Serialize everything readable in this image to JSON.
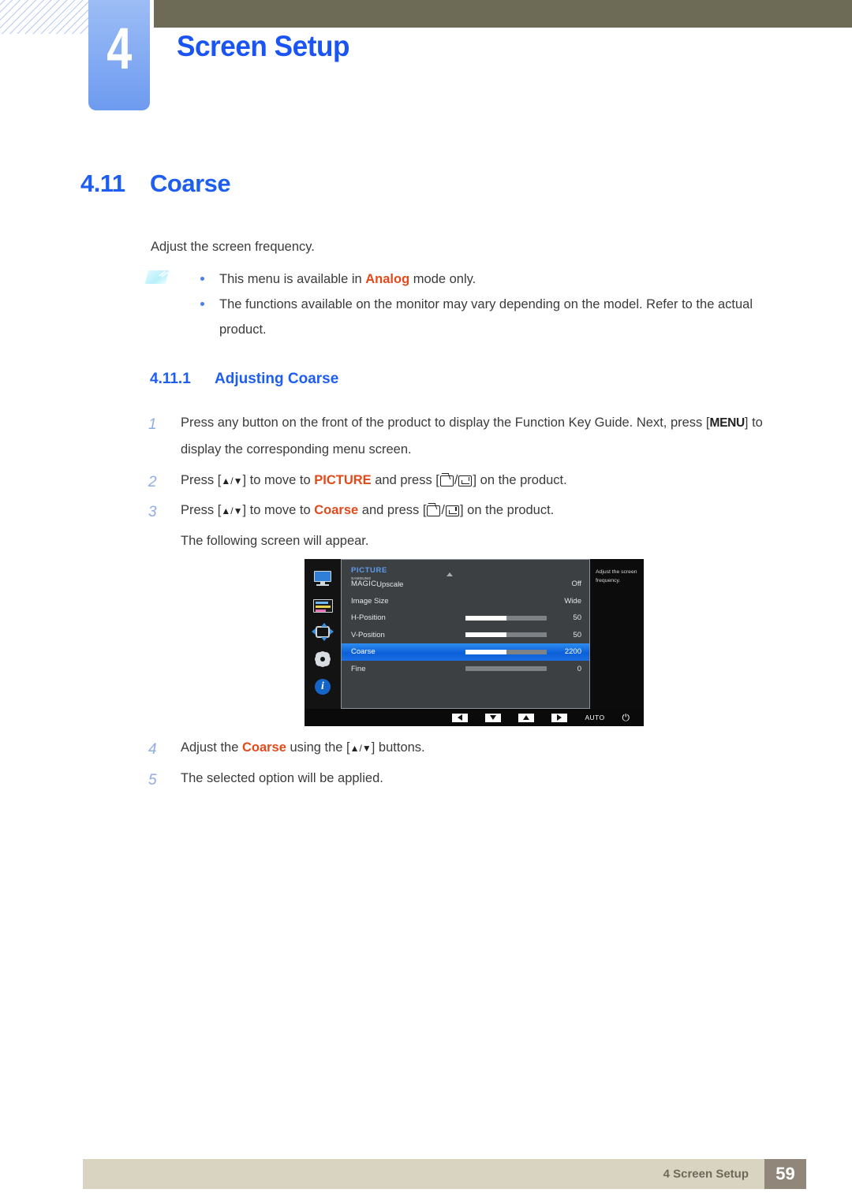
{
  "chapter": {
    "number": "4",
    "title": "Screen Setup"
  },
  "section": {
    "number": "4.11",
    "title": "Coarse",
    "intro": "Adjust the screen frequency."
  },
  "note": {
    "icon": "note-pencil-icon",
    "bullets": [
      {
        "prefix": "This menu is available in ",
        "keyword": "Analog",
        "suffix": " mode only."
      },
      {
        "prefix": "The functions available on the monitor may vary depending on the model. Refer to the actual product.",
        "keyword": "",
        "suffix": ""
      }
    ]
  },
  "subsection": {
    "number": "4.11.1",
    "title": "Adjusting Coarse"
  },
  "steps": [
    {
      "num": "1",
      "text_a": "Press any button on the front of the product to display the Function Key Guide. Next, press [",
      "key": "MENU",
      "text_b": "] to display the corresponding menu screen."
    },
    {
      "num": "2",
      "text_a": "Press [",
      "arrows": "▲/▼",
      "text_b": "] to move to ",
      "keyword": "PICTURE",
      "text_c": " and press [",
      "text_d": "] on the product."
    },
    {
      "num": "3",
      "text_a": "Press [",
      "arrows": "▲/▼",
      "text_b": "] to move to ",
      "keyword": "Coarse",
      "text_c": " and press [",
      "text_d": "] on the product.",
      "note": "The following screen will appear."
    },
    {
      "num": "4",
      "text_a": "Adjust the ",
      "keyword": "Coarse",
      "text_b": " using the [",
      "arrows": "▲/▼",
      "text_c": "] buttons."
    },
    {
      "num": "5",
      "text_a": "The selected option will be applied."
    }
  ],
  "osd": {
    "menu_title": "PICTURE",
    "sidebar_icons": [
      "monitor-icon",
      "color-bars-icon",
      "screen-adjust-icon",
      "gear-icon",
      "info-icon"
    ],
    "rows": [
      {
        "label_samsung": "SAMSUNG",
        "label_magic": "MAGIC",
        "label_extra": "Upscale",
        "value": "Off",
        "slider": null,
        "selected": false
      },
      {
        "label": "Image Size",
        "value": "Wide",
        "slider": null,
        "selected": false
      },
      {
        "label": "H-Position",
        "value": "50",
        "slider": 50,
        "selected": false
      },
      {
        "label": "V-Position",
        "value": "50",
        "slider": 50,
        "selected": false
      },
      {
        "label": "Coarse",
        "value": "2200",
        "slider": 50,
        "selected": true
      },
      {
        "label": "Fine",
        "value": "0",
        "slider": 0,
        "selected": false
      }
    ],
    "description": "Adjust the screen frequency.",
    "keybar": [
      {
        "icon": "arrow-left-button",
        "label": ""
      },
      {
        "icon": "arrow-down-button",
        "label": ""
      },
      {
        "icon": "arrow-up-button",
        "label": ""
      },
      {
        "icon": "arrow-right-button",
        "label": ""
      },
      {
        "icon": "auto-button",
        "label": "AUTO"
      },
      {
        "icon": "power-button",
        "label": "⏻"
      }
    ]
  },
  "footer": {
    "label": "4 Screen Setup",
    "page": "59"
  },
  "colors": {
    "heading_blue": "#1d5ef0",
    "keyword_red": "#e24a1b",
    "top_band": "#6d6a55",
    "tab_blue": "#6e9bf0",
    "footer_bar": "#d9d4c2",
    "footer_page": "#91867a"
  }
}
